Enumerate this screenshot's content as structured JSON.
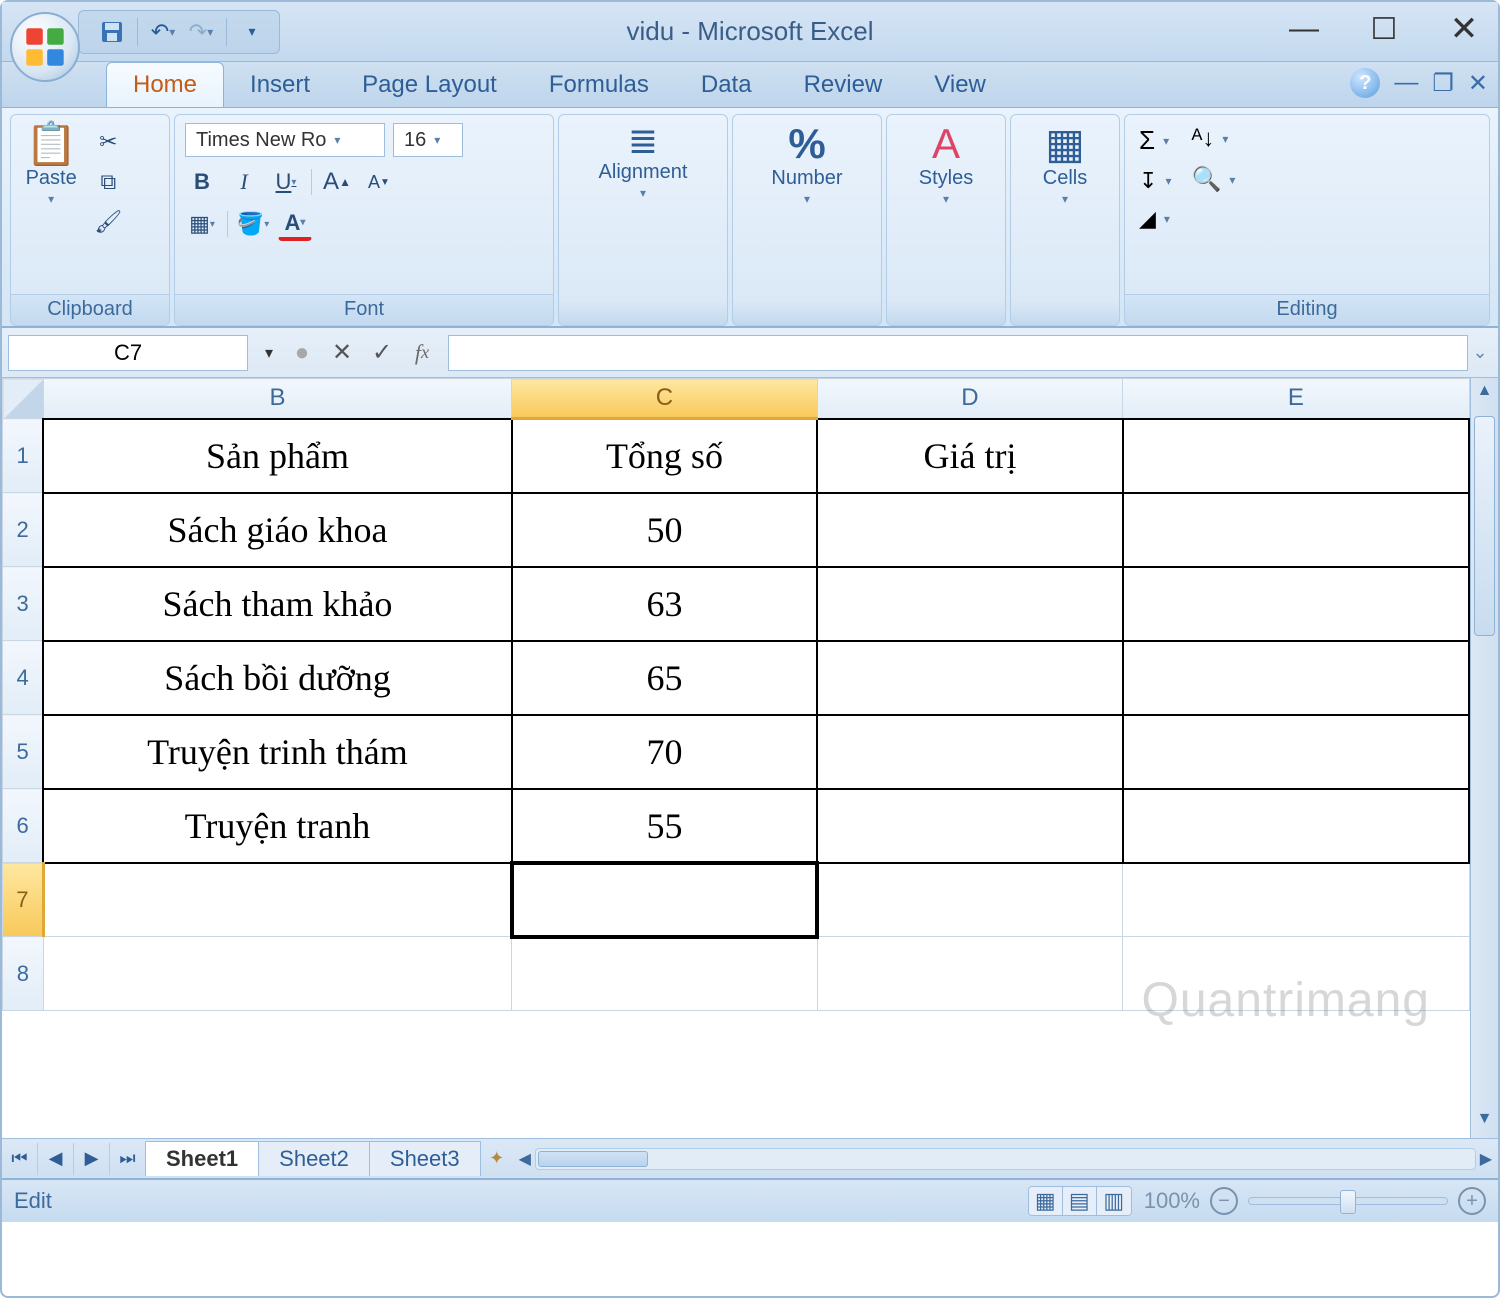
{
  "title": "vidu - Microsoft Excel",
  "qat": {
    "save": "💾",
    "undo": "↶",
    "redo": "↷"
  },
  "tabs": [
    "Home",
    "Insert",
    "Page Layout",
    "Formulas",
    "Data",
    "Review",
    "View"
  ],
  "active_tab": "Home",
  "groups": {
    "clipboard": {
      "title": "Clipboard",
      "paste": "Paste"
    },
    "font": {
      "title": "Font",
      "name": "Times New Ro",
      "size": "16",
      "bold": "B",
      "italic": "I",
      "underline": "U",
      "grow": "A",
      "shrink": "A"
    },
    "alignment": {
      "title": "Alignment"
    },
    "number": {
      "title": "Number",
      "percent": "%"
    },
    "styles": {
      "title": "Styles"
    },
    "cells": {
      "title": "Cells"
    },
    "editing": {
      "title": "Editing",
      "sigma": "Σ"
    }
  },
  "namebox": "C7",
  "formula": "",
  "columns": [
    "B",
    "C",
    "D",
    "E"
  ],
  "selected_col": "C",
  "rows": [
    "1",
    "2",
    "3",
    "4",
    "5",
    "6",
    "7",
    "8"
  ],
  "selected_row": "7",
  "cells": {
    "r1": {
      "B": "Sản phẩm",
      "C": "Tổng số",
      "D": "Giá trị",
      "E": ""
    },
    "r2": {
      "B": "Sách giáo khoa",
      "C": "50",
      "D": "",
      "E": ""
    },
    "r3": {
      "B": "Sách tham khảo",
      "C": "63",
      "D": "",
      "E": ""
    },
    "r4": {
      "B": "Sách bồi dưỡng",
      "C": "65",
      "D": "",
      "E": ""
    },
    "r5": {
      "B": "Truyện trinh thám",
      "C": "70",
      "D": "",
      "E": ""
    },
    "r6": {
      "B": "Truyện tranh",
      "C": "55",
      "D": "",
      "E": ""
    },
    "r7": {
      "B": "",
      "C": "",
      "D": "",
      "E": ""
    },
    "r8": {
      "B": "",
      "C": "",
      "D": "",
      "E": ""
    }
  },
  "sheets": [
    "Sheet1",
    "Sheet2",
    "Sheet3"
  ],
  "active_sheet": "Sheet1",
  "status_mode": "Edit",
  "zoom": "100%",
  "watermark": "Quantrimang"
}
